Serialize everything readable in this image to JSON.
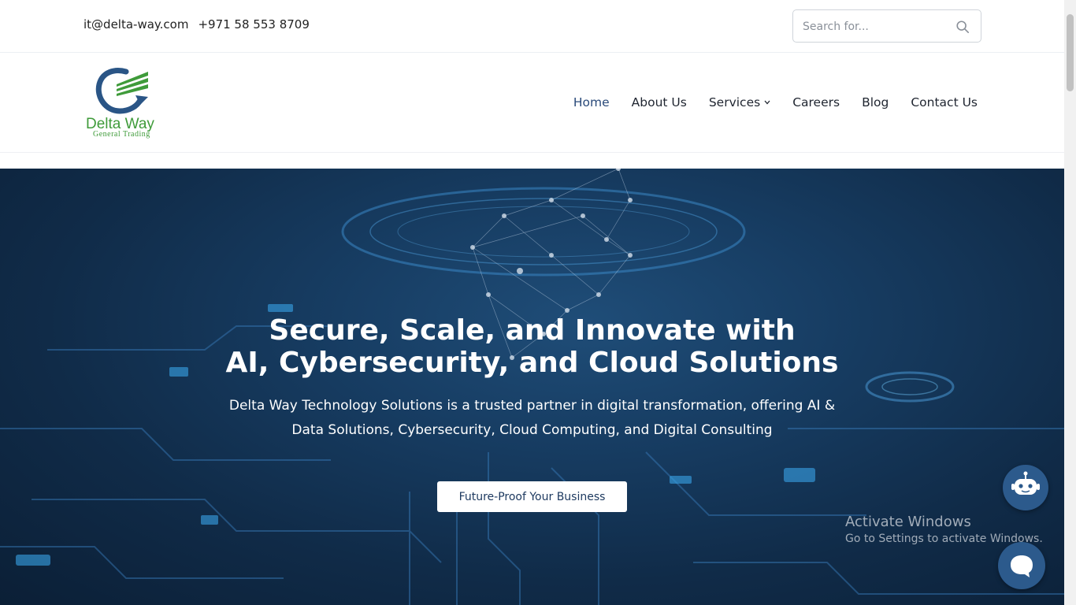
{
  "topbar": {
    "email": "it@delta-way.com",
    "phone": "+971 58 553 8709",
    "search_placeholder": "Search for..."
  },
  "brand": {
    "name": "Delta Way",
    "tagline": "General Trading"
  },
  "nav": {
    "items": [
      {
        "label": "Home",
        "active": true
      },
      {
        "label": "About Us"
      },
      {
        "label": "Services",
        "dropdown": true
      },
      {
        "label": "Careers"
      },
      {
        "label": "Blog"
      },
      {
        "label": "Contact Us"
      }
    ]
  },
  "hero": {
    "title_line1": "Secure, Scale, and Innovate with",
    "title_line2": "AI, Cybersecurity, and Cloud Solutions",
    "subtitle": "Delta Way Technology Solutions is a trusted partner in digital transformation, offering AI & Data Solutions, Cybersecurity, Cloud Computing, and Digital Consulting",
    "cta_label": "Future-Proof Your Business"
  },
  "watermark": {
    "title": "Activate Windows",
    "subtitle": "Go to Settings to activate Windows."
  },
  "icons": {
    "search": "search-icon",
    "chevron": "chevron-down-icon",
    "bot": "robot-icon",
    "chat": "chat-bubble-icon"
  },
  "colors": {
    "brand_green": "#3f9b3a",
    "brand_blue": "#2a5586",
    "nav_active": "#2a4a7a",
    "hero_bg": "#143659",
    "float_button": "#2c5a8c"
  }
}
